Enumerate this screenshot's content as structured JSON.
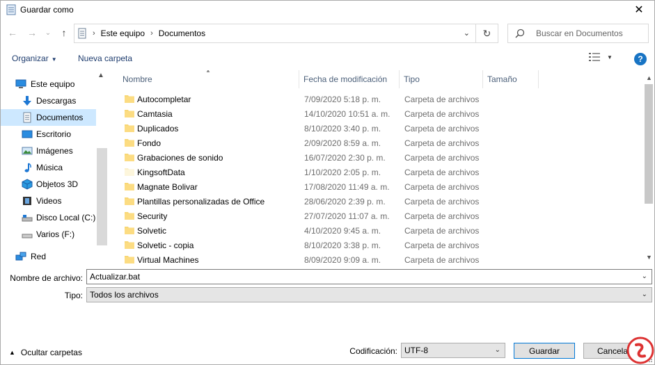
{
  "window": {
    "title": "Guardar como",
    "close_glyph": "✕"
  },
  "nav": {
    "back_glyph": "←",
    "forward_glyph": "→",
    "recent_glyph": "⌄",
    "up_glyph": "↑",
    "breadcrumb": [
      "Este equipo",
      "Documentos"
    ],
    "sep_glyph": "›",
    "refresh_glyph": "↻",
    "search_placeholder": "Buscar en Documentos"
  },
  "toolbar": {
    "organize_label": "Organizar",
    "new_folder_label": "Nueva carpeta",
    "help_glyph": "?"
  },
  "sidebar": {
    "items": [
      {
        "label": "Este equipo",
        "icon": "computer-icon"
      },
      {
        "label": "Descargas",
        "icon": "download-icon"
      },
      {
        "label": "Documentos",
        "icon": "documents-icon",
        "selected": true
      },
      {
        "label": "Escritorio",
        "icon": "desktop-icon"
      },
      {
        "label": "Imágenes",
        "icon": "pictures-icon"
      },
      {
        "label": "Música",
        "icon": "music-icon"
      },
      {
        "label": "Objetos 3D",
        "icon": "objects3d-icon"
      },
      {
        "label": "Videos",
        "icon": "videos-icon"
      },
      {
        "label": "Disco Local (C:)",
        "icon": "drive-icon"
      },
      {
        "label": "Varios (F:)",
        "icon": "drive-icon"
      },
      {
        "label": "Red",
        "icon": "network-icon"
      }
    ]
  },
  "columns": [
    "Nombre",
    "Fecha de modificación",
    "Tipo",
    "Tamaño"
  ],
  "files": [
    {
      "name": "Autocompletar",
      "date": "7/09/2020 5:18 p. m.",
      "type": "Carpeta de archivos"
    },
    {
      "name": "Camtasia",
      "date": "14/10/2020 10:51 a. m.",
      "type": "Carpeta de archivos"
    },
    {
      "name": "Duplicados",
      "date": "8/10/2020 3:40 p. m.",
      "type": "Carpeta de archivos"
    },
    {
      "name": "Fondo",
      "date": "2/09/2020 8:59 a. m.",
      "type": "Carpeta de archivos"
    },
    {
      "name": "Grabaciones de sonido",
      "date": "16/07/2020 2:30 p. m.",
      "type": "Carpeta de archivos"
    },
    {
      "name": "KingsoftData",
      "date": "1/10/2020 2:05 p. m.",
      "type": "Carpeta de archivos"
    },
    {
      "name": "Magnate Bolivar",
      "date": "17/08/2020 11:49 a. m.",
      "type": "Carpeta de archivos"
    },
    {
      "name": "Plantillas personalizadas de Office",
      "date": "28/06/2020 2:39 p. m.",
      "type": "Carpeta de archivos"
    },
    {
      "name": "Security",
      "date": "27/07/2020 11:07 a. m.",
      "type": "Carpeta de archivos"
    },
    {
      "name": "Solvetic",
      "date": "4/10/2020 9:45 a. m.",
      "type": "Carpeta de archivos"
    },
    {
      "name": "Solvetic - copia",
      "date": "8/10/2020 3:38 p. m.",
      "type": "Carpeta de archivos"
    },
    {
      "name": "Virtual Machines",
      "date": "8/09/2020 9:09 a. m.",
      "type": "Carpeta de archivos"
    }
  ],
  "form": {
    "filename_label": "Nombre de archivo:",
    "filename_value": "Actualizar.bat",
    "type_label": "Tipo:",
    "type_value": "Todos los archivos",
    "encoding_label": "Codificación:",
    "encoding_value": "UTF-8"
  },
  "footer": {
    "hide_folders_label": "Ocultar carpetas",
    "save_label": "Guardar",
    "cancel_label": "Cancelar"
  },
  "colors": {
    "folder": "#f8d775",
    "selection": "#cde8ff",
    "link": "#1e3c6e",
    "help": "#1874c4"
  }
}
